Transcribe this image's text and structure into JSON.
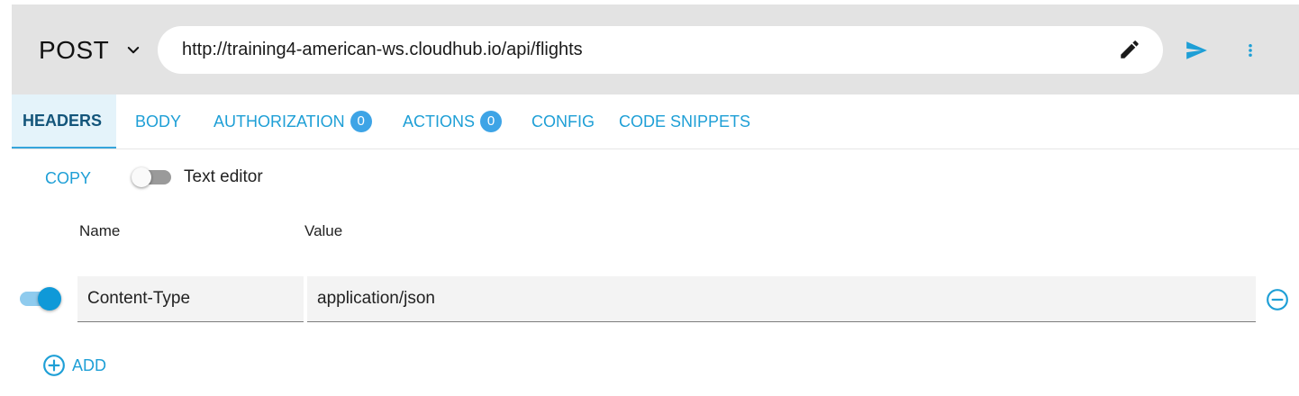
{
  "request": {
    "method": "POST",
    "url": "http://training4-american-ws.cloudhub.io/api/flights"
  },
  "tabs": [
    {
      "label": "HEADERS",
      "active": true
    },
    {
      "label": "BODY"
    },
    {
      "label": "AUTHORIZATION",
      "badge": "0"
    },
    {
      "label": "ACTIONS",
      "badge": "0"
    },
    {
      "label": "CONFIG"
    },
    {
      "label": "CODE SNIPPETS"
    }
  ],
  "headers_panel": {
    "copy_label": "COPY",
    "text_editor_label": "Text editor",
    "text_editor_enabled": false,
    "column_name": "Name",
    "column_value": "Value",
    "rows": [
      {
        "enabled": true,
        "name": "Content-Type",
        "value": "application/json"
      }
    ],
    "add_label": "ADD"
  },
  "icons": {
    "method_dropdown": "chevron-down-icon",
    "edit_url": "pencil-icon",
    "send": "send-icon",
    "more": "more-vertical-icon",
    "remove_row": "minus-circle-icon",
    "add_row": "plus-circle-icon"
  },
  "colors": {
    "accent": "#1e9fd6",
    "active_tab_text": "#13557a",
    "active_tab_bg": "#e4f3fa",
    "badge": "#3ea4e6",
    "toggle_on": "#0f99d8",
    "request_bar_bg": "#e3e3e3"
  }
}
